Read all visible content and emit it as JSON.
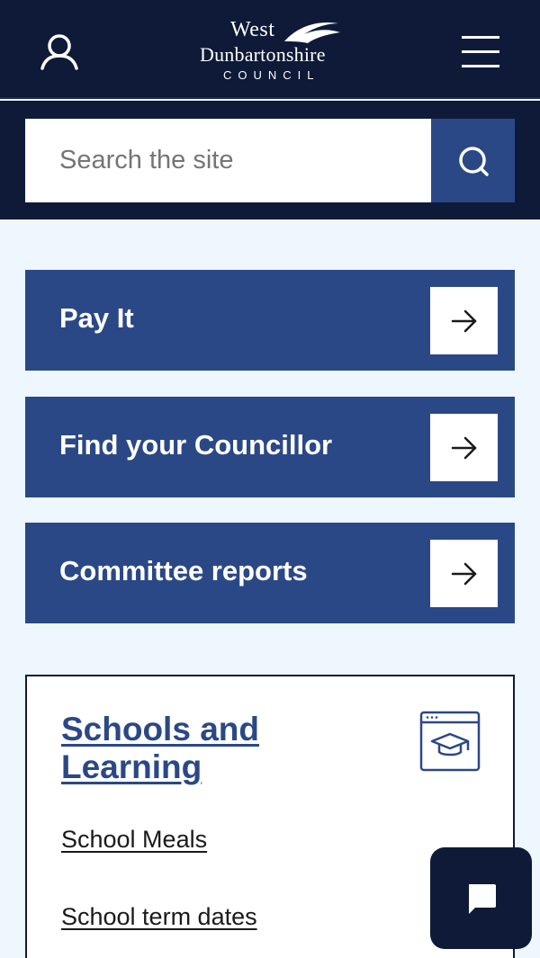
{
  "header": {
    "logo": {
      "line1": "West",
      "line2": "Dunbartonshire",
      "line3": "COUNCIL"
    },
    "account_icon": "user-icon",
    "menu_icon": "hamburger-menu-icon"
  },
  "search": {
    "placeholder": "Search the site",
    "value": "",
    "icon": "search-icon"
  },
  "quick_links": [
    {
      "label": "Pay It",
      "icon": "arrow-right-icon"
    },
    {
      "label": "Find your Councillor",
      "icon": "arrow-right-icon"
    },
    {
      "label": "Committee reports",
      "icon": "arrow-right-icon"
    }
  ],
  "card": {
    "title": "Schools and Learning",
    "icon": "graduation-cap-window-icon",
    "links": [
      {
        "label": "School Meals"
      },
      {
        "label": "School term dates"
      }
    ]
  },
  "chat": {
    "icon": "chat-bubble-icon"
  },
  "colors": {
    "header_bg": "#0e1a38",
    "accent": "#2b4886",
    "page_bg": "#eef6fe"
  }
}
